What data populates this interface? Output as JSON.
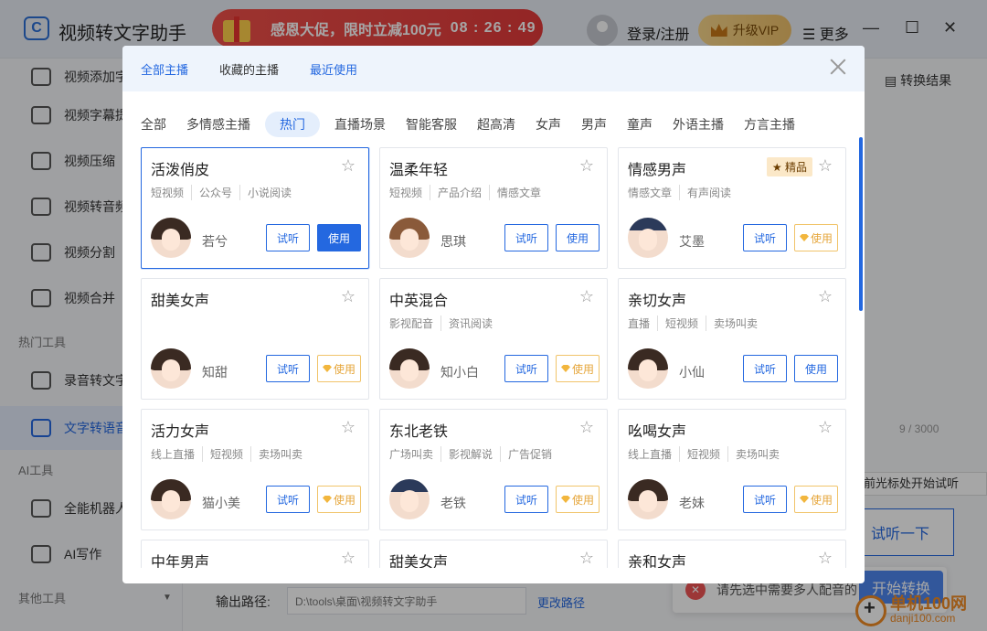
{
  "app": {
    "title": "视频转文字助手"
  },
  "promo": {
    "text": "感恩大促，限时立减100元",
    "timer": "08 : 26 : 49"
  },
  "header": {
    "login": "登录/注册",
    "vip": "升级VIP",
    "more": "更多"
  },
  "sidebar": {
    "items": [
      {
        "label": "视频添加字"
      },
      {
        "label": "视频字幕提"
      },
      {
        "label": "视频压缩"
      },
      {
        "label": "视频转音频"
      },
      {
        "label": "视频分割"
      },
      {
        "label": "视频合并"
      }
    ],
    "hot_heading": "热门工具",
    "hot_items": [
      {
        "label": "录音转文字"
      },
      {
        "label": "文字转语音"
      }
    ],
    "ai_heading": "AI工具",
    "ai_items": [
      {
        "label": "全能机器人"
      },
      {
        "label": "AI写作"
      }
    ],
    "other_heading": "其他工具"
  },
  "main": {
    "result_link": "转换结果",
    "counter": "9 / 3000",
    "tip": "前光标处开始试听",
    "listen_button": "试听一下",
    "output_label": "输出路径:",
    "output_path": "D:\\tools\\桌面\\视频转文字助手",
    "change_path": "更改路径",
    "toast": "请先选中需要多人配音的",
    "start": "开始转换",
    "watermark1": "单机100网",
    "watermark2": "danji100.com"
  },
  "modal": {
    "tabs": [
      "全部主播",
      "收藏的主播",
      "最近使用"
    ],
    "categories": [
      "全部",
      "多情感主播",
      "热门",
      "直播场景",
      "智能客服",
      "超高清",
      "女声",
      "男声",
      "童声",
      "外语主播",
      "方言主播"
    ],
    "active_category": "热门",
    "try_label": "试听",
    "use_label": "使用",
    "badge": "★ 精品",
    "cards": [
      {
        "title": "活泼俏皮",
        "tags": [
          "短视频",
          "公众号",
          "小说阅读"
        ],
        "voice": "若兮",
        "use": "primary"
      },
      {
        "title": "温柔年轻",
        "tags": [
          "短视频",
          "产品介绍",
          "情感文章"
        ],
        "voice": "思琪",
        "use": "normal"
      },
      {
        "title": "情感男声",
        "tags": [
          "情感文章",
          "有声阅读"
        ],
        "voice": "艾墨",
        "use": "vip"
      },
      {
        "title": "甜美女声",
        "tags": [],
        "voice": "知甜",
        "use": "vip"
      },
      {
        "title": "中英混合",
        "tags": [
          "影视配音",
          "资讯阅读"
        ],
        "voice": "知小白",
        "use": "vip"
      },
      {
        "title": "亲切女声",
        "tags": [
          "直播",
          "短视频",
          "卖场叫卖"
        ],
        "voice": "小仙",
        "use": "normal"
      },
      {
        "title": "活力女声",
        "tags": [
          "线上直播",
          "短视频",
          "卖场叫卖"
        ],
        "voice": "猫小美",
        "use": "vip"
      },
      {
        "title": "东北老铁",
        "tags": [
          "广场叫卖",
          "影视解说",
          "广告促销"
        ],
        "voice": "老铁",
        "use": "vip"
      },
      {
        "title": "吆喝女声",
        "tags": [
          "线上直播",
          "短视频",
          "卖场叫卖"
        ],
        "voice": "老妹",
        "use": "vip"
      },
      {
        "title": "中年男声",
        "tags": [],
        "voice": "",
        "use": "normal"
      },
      {
        "title": "甜美女声",
        "tags": [],
        "voice": "",
        "use": "normal"
      },
      {
        "title": "亲和女声",
        "tags": [],
        "voice": "",
        "use": "normal"
      }
    ]
  }
}
